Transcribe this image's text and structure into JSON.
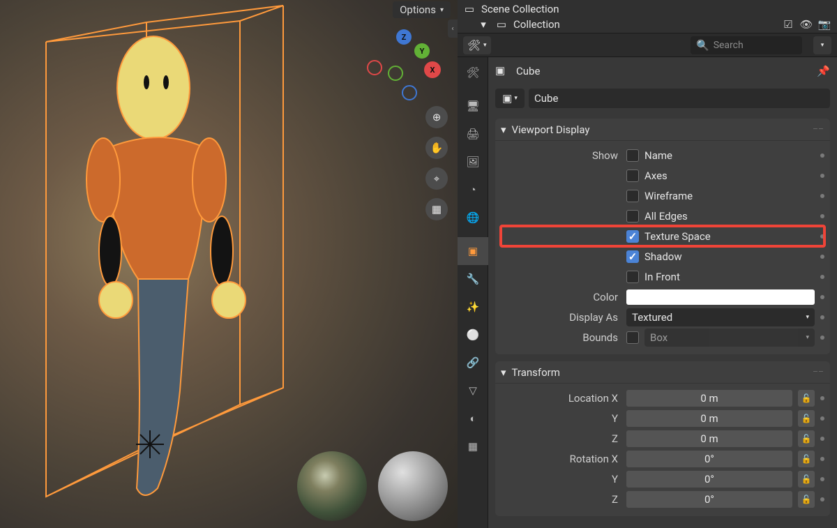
{
  "viewport": {
    "options_label": "Options",
    "tools": [
      {
        "name": "zoom-icon",
        "glyph": "⊕"
      },
      {
        "name": "pan-icon",
        "glyph": "✋"
      },
      {
        "name": "orbit-icon",
        "glyph": "⌖"
      },
      {
        "name": "persp-icon",
        "glyph": "▦"
      }
    ]
  },
  "outliner": {
    "scene_collection": "Scene Collection",
    "collection": "Collection"
  },
  "properties_header": {
    "search_placeholder": "Search"
  },
  "crumb": {
    "object": "Cube"
  },
  "object_name_field": "Cube",
  "viewport_display": {
    "title": "Viewport Display",
    "show_label": "Show",
    "show_options": [
      {
        "key": "name",
        "label": "Name",
        "checked": false
      },
      {
        "key": "axes",
        "label": "Axes",
        "checked": false
      },
      {
        "key": "wireframe",
        "label": "Wireframe",
        "checked": false
      },
      {
        "key": "all_edges",
        "label": "All Edges",
        "checked": false
      },
      {
        "key": "texture_space",
        "label": "Texture Space",
        "checked": true,
        "highlight": true
      },
      {
        "key": "shadow",
        "label": "Shadow",
        "checked": true
      },
      {
        "key": "in_front",
        "label": "In Front",
        "checked": false
      }
    ],
    "color_label": "Color",
    "color_value": "#ffffff",
    "display_as_label": "Display As",
    "display_as_value": "Textured",
    "bounds_label": "Bounds",
    "bounds_checked": false,
    "bounds_type": "Box"
  },
  "transform": {
    "title": "Transform",
    "rows": [
      {
        "label": "Location X",
        "value": "0 m"
      },
      {
        "label": "Y",
        "value": "0 m"
      },
      {
        "label": "Z",
        "value": "0 m"
      },
      {
        "label": "Rotation X",
        "value": "0°"
      },
      {
        "label": "Y",
        "value": "0°"
      },
      {
        "label": "Z",
        "value": "0°"
      }
    ]
  }
}
